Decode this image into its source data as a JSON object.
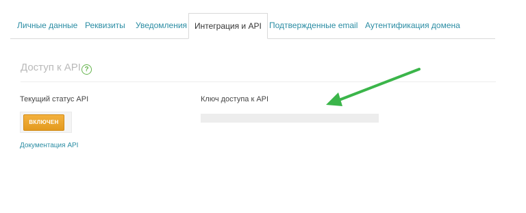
{
  "tabs": [
    {
      "label": "Личные данные",
      "active": false
    },
    {
      "label": "Реквизиты",
      "active": false
    },
    {
      "label": "Уведомления",
      "active": false
    },
    {
      "label": "Интеграция и API",
      "active": true
    },
    {
      "label": "Подтвержденные email",
      "active": false
    },
    {
      "label": "Аутентификация домена",
      "active": false
    }
  ],
  "section": {
    "title": "Доступ к API",
    "help_icon_glyph": "?"
  },
  "api_status": {
    "label": "Текущий статус API",
    "button_label": "ВКЛЮЧЕН",
    "doc_link": "Документация API"
  },
  "api_key": {
    "label": "Ключ доступа к API",
    "value": ""
  },
  "colors": {
    "link": "#2a8ca3",
    "button": "#eba52b",
    "annotation_arrow": "#3bb54a",
    "help_icon": "#63b34a"
  },
  "icons": {
    "help": "help-circle-icon",
    "arrow": "annotation-arrow-icon"
  }
}
